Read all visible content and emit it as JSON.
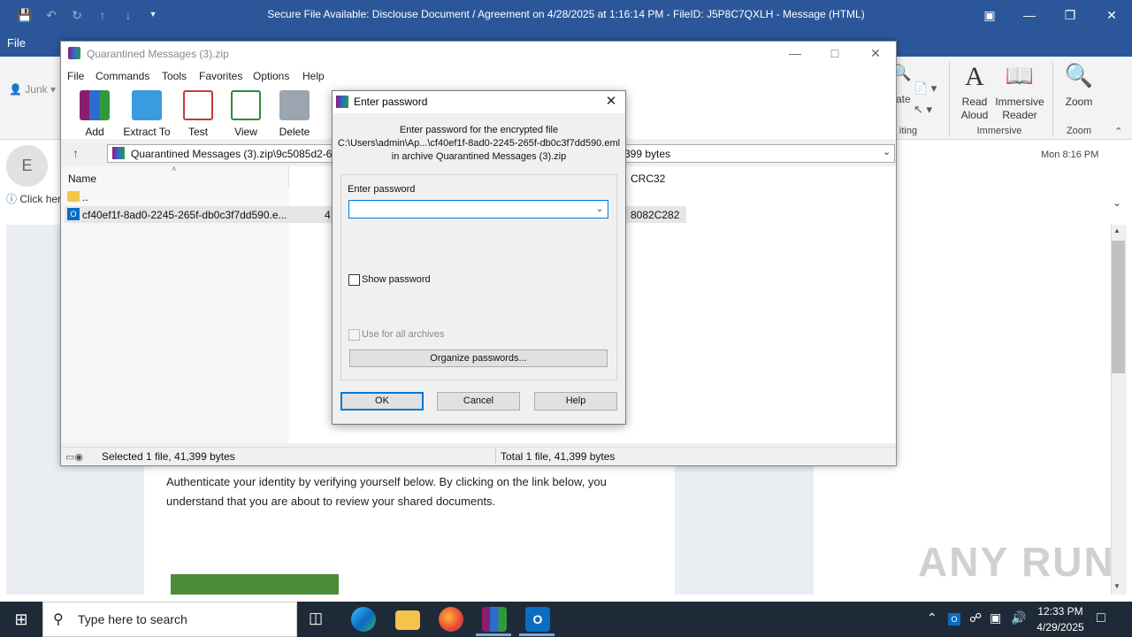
{
  "outlook": {
    "title": "Secure File Available: Disclouse Document / Agreement on 4/28/2025 at 1:16:14 PM - FileID: J5P8C7QXLH  -  Message (HTML)",
    "file_tab": "File",
    "junk_label": "Junk",
    "avatar_initial": "E",
    "info_text": "Click her",
    "date": "Mon 8:16 PM",
    "ribbon": {
      "read_aloud": "Read Aloud",
      "immersive_reader": "Immersive Reader",
      "zoom": "Zoom",
      "group_editing": "iting",
      "group_immersive": "Immersive",
      "group_zoom": "Zoom",
      "partial_ate": "ate"
    },
    "body_text": "Authenticate your identity by verifying yourself below. By clicking on the link below, you understand that you are about to review your shared documents.",
    "watermark": "ANY RUN"
  },
  "winrar": {
    "title": "Quarantined Messages (3).zip",
    "menu": [
      "File",
      "Commands",
      "Tools",
      "Favorites",
      "Options",
      "Help"
    ],
    "toolbar": [
      "Add",
      "Extract To",
      "Test",
      "View",
      "Delete"
    ],
    "path": "Quarantined Messages (3).zip\\9c5085d2-6e",
    "path_size": "399 bytes",
    "columns": {
      "name": "Name",
      "crc": "CRC32"
    },
    "rows": [
      {
        "name": "..",
        "size": "",
        "crc": ""
      },
      {
        "name": "cf40ef1f-8ad0-2245-265f-db0c3f7dd590.e...",
        "size": "4",
        "crc": "8082C282"
      }
    ],
    "status_left": "Selected 1 file, 41,399 bytes",
    "status_right": "Total 1 file, 41,399 bytes"
  },
  "password_dialog": {
    "title": "Enter password",
    "message_line1": "Enter password for the encrypted file",
    "message_line2": "C:\\Users\\admin\\Ap...\\cf40ef1f-8ad0-2245-265f-db0c3f7dd590.eml",
    "message_line3": "in archive Quarantined Messages (3).zip",
    "field_label": "Enter password",
    "field_value": "",
    "show_password": "Show password",
    "use_for_all": "Use for all archives",
    "organize": "Organize passwords...",
    "ok": "OK",
    "cancel": "Cancel",
    "help": "Help"
  },
  "taskbar": {
    "search_placeholder": "Type here to search",
    "time": "12:33 PM",
    "date": "4/29/2025"
  }
}
